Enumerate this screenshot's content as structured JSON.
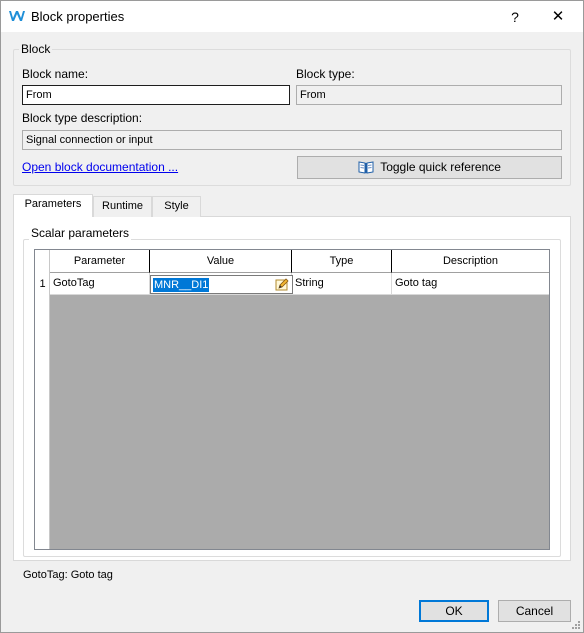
{
  "window": {
    "title": "Block properties",
    "help_label": "?",
    "close_label": "✕"
  },
  "block_group": {
    "legend": "Block",
    "name_label": "Block name:",
    "name_value": "From",
    "type_label": "Block type:",
    "type_value": "From",
    "desc_label": "Block type description:",
    "desc_value": "Signal connection or input",
    "doc_link": "Open block documentation ...",
    "quick_ref_label": "Toggle quick reference"
  },
  "tabs": [
    {
      "label": "Parameters",
      "active": true
    },
    {
      "label": "Runtime",
      "active": false
    },
    {
      "label": "Style",
      "active": false
    }
  ],
  "scalar_group": {
    "legend": "Scalar parameters"
  },
  "table": {
    "columns": [
      "Parameter",
      "Value",
      "Type",
      "Description"
    ],
    "rows": [
      {
        "num": "1",
        "parameter": "GotoTag",
        "value": "MNR__DI1",
        "type": "String",
        "description": "Goto tag"
      }
    ]
  },
  "status_text": "GotoTag: Goto tag",
  "buttons": {
    "ok": "OK",
    "cancel": "Cancel"
  },
  "colors": {
    "accent": "#0078d7",
    "app_icon": "#1f8fd8",
    "link": "#0000ee"
  },
  "icons": [
    "app-logo-icon",
    "help-icon",
    "close-icon",
    "book-icon",
    "edit-icon",
    "resize-grip-icon"
  ]
}
